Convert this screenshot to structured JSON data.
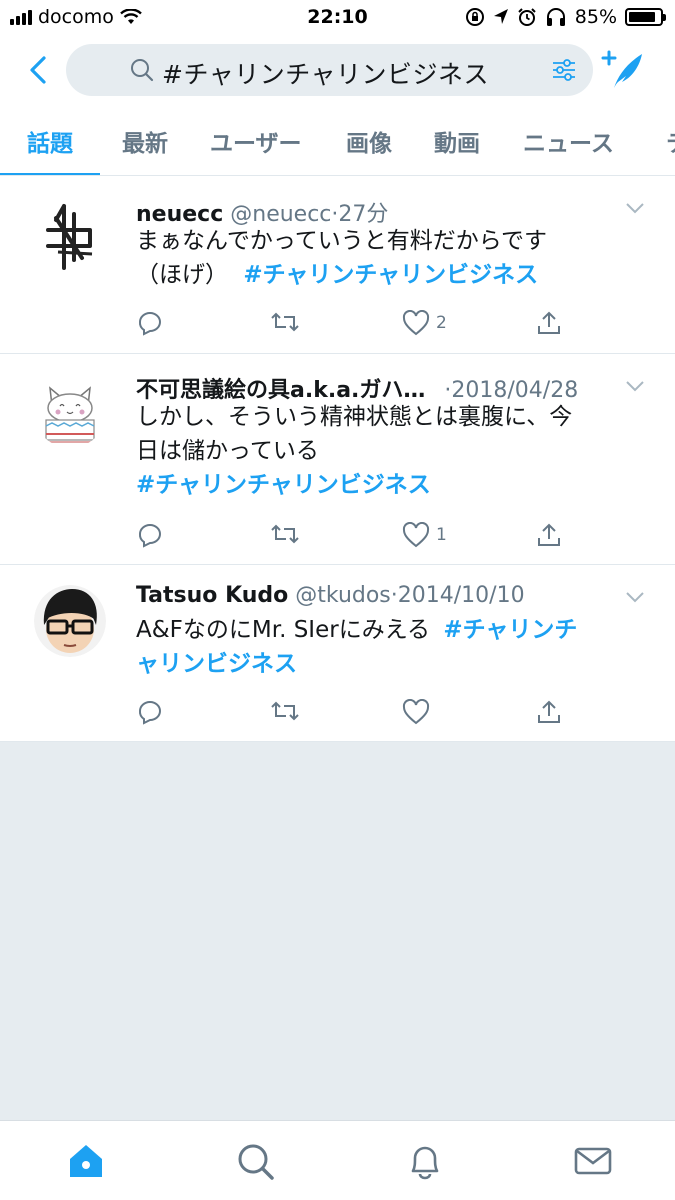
{
  "status_bar": {
    "carrier": "docomo",
    "time": "22:10",
    "battery_percent": "85%",
    "battery_level": 0.85
  },
  "search": {
    "query": "#チャリンチャリンビジネス"
  },
  "tabs": [
    {
      "label": "話題",
      "active": true
    },
    {
      "label": "最新",
      "active": false
    },
    {
      "label": "ユーザー",
      "active": false
    },
    {
      "label": "画像",
      "active": false
    },
    {
      "label": "動画",
      "active": false
    },
    {
      "label": "ニュース",
      "active": false
    },
    {
      "label": "テ",
      "active": false
    }
  ],
  "tweets": [
    {
      "name": "neuecc",
      "handle": "@neuecc",
      "time": "27分",
      "text_line1": "まぁなんでかっていうと有料だからです",
      "text_line2": "（ほげ）",
      "hashtag": "#チャリンチャリンビジネス",
      "likes": "2",
      "retweets": ""
    },
    {
      "name": "不可思議絵の具a.k.a.ガハ…",
      "handle": "",
      "time": "2018/04/28",
      "text_line1": "しかし、そういう精神状態とは裏腹に、今",
      "text_line2": "日は儲かっている",
      "hashtag": "#チャリンチャリンビジネス",
      "likes": "1",
      "retweets": ""
    },
    {
      "name": "Tatsuo Kudo",
      "handle": "@tkudos",
      "time": "2014/10/10",
      "text_line1": "A&FなのにMr. SIerにみえる",
      "hashtag_part1": "#チャリンチ",
      "hashtag_part2": "ャリンビジネス",
      "likes": "",
      "retweets": ""
    }
  ],
  "colors": {
    "accent": "#1da1f2",
    "text_secondary": "#657786",
    "background": "#e6ecf0"
  }
}
